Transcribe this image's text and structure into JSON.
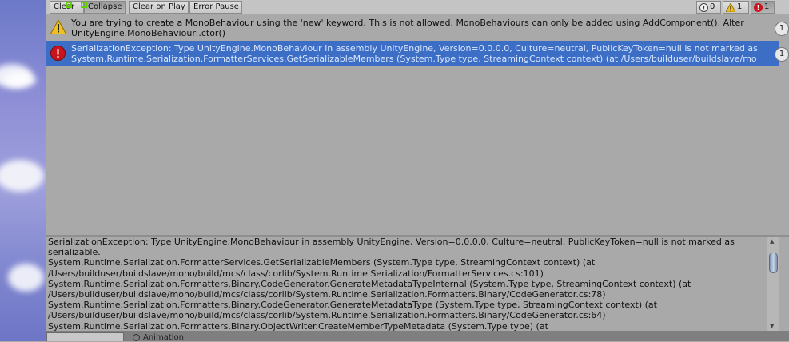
{
  "toolbar": {
    "clear": "Clear",
    "collapse": "Collapse",
    "clear_on_play": "Clear on Play",
    "error_pause": "Error Pause",
    "info_count": "0",
    "warning_count": "1",
    "error_count": "1"
  },
  "log": [
    {
      "type": "warning",
      "line1": "You are trying to create a MonoBehaviour using the 'new' keyword.  This is not allowed.  MonoBehaviours can only be added using AddComponent().  Alter",
      "line2": "UnityEngine.MonoBehaviour:.ctor()",
      "count": "1",
      "selected": false
    },
    {
      "type": "error",
      "line1": "SerializationException: Type UnityEngine.MonoBehaviour in assembly UnityEngine, Version=0.0.0.0, Culture=neutral, PublicKeyToken=null is not marked as",
      "line2": "System.Runtime.Serialization.FormatterServices.GetSerializableMembers (System.Type type, StreamingContext context) (at /Users/builduser/buildslave/mo",
      "count": "1",
      "selected": true
    }
  ],
  "detail_text": "SerializationException: Type UnityEngine.MonoBehaviour in assembly UnityEngine, Version=0.0.0.0, Culture=neutral, PublicKeyToken=null is not marked as\nserializable.\nSystem.Runtime.Serialization.FormatterServices.GetSerializableMembers (System.Type type, StreamingContext context) (at\n/Users/builduser/buildslave/mono/build/mcs/class/corlib/System.Runtime.Serialization/FormatterServices.cs:101)\nSystem.Runtime.Serialization.Formatters.Binary.CodeGenerator.GenerateMetadataTypeInternal (System.Type type, StreamingContext context) (at\n/Users/builduser/buildslave/mono/build/mcs/class/corlib/System.Runtime.Serialization.Formatters.Binary/CodeGenerator.cs:78)\nSystem.Runtime.Serialization.Formatters.Binary.CodeGenerator.GenerateMetadataType (System.Type type, StreamingContext context) (at\n/Users/builduser/buildslave/mono/build/mcs/class/corlib/System.Runtime.Serialization.Formatters.Binary/CodeGenerator.cs:64)\nSystem.Runtime.Serialization.Formatters.Binary.ObjectWriter.CreateMemberTypeMetadata (System.Type type) (at",
  "bottom_tab": {
    "label": "Animation"
  },
  "colors": {
    "selection": "#3d6ec6",
    "error_red": "#c8141a",
    "warning_yellow": "#f0c020",
    "marker_green": "#5fd000"
  }
}
